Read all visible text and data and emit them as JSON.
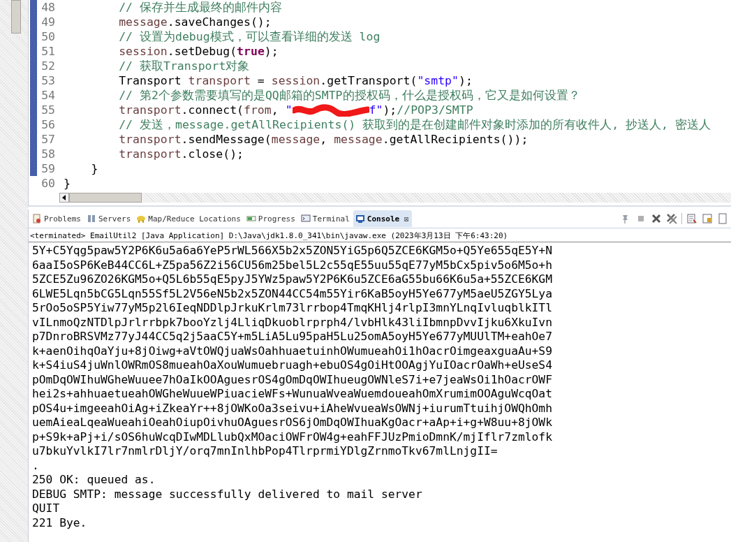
{
  "editor": {
    "lines": [
      {
        "number": "48",
        "marked": true,
        "kind": "body",
        "tokens": [
          {
            "kind": "comment",
            "text": "// 保存并生成最终的邮件内容"
          }
        ]
      },
      {
        "number": "49",
        "marked": true,
        "kind": "body",
        "tokens": [
          {
            "kind": "variable",
            "text": "message"
          },
          {
            "kind": "plain",
            "text": ".saveChanges();"
          }
        ]
      },
      {
        "number": "50",
        "marked": true,
        "kind": "body",
        "tokens": [
          {
            "kind": "comment",
            "text": "// 设置为debug模式，可以查看详细的发送 log"
          }
        ]
      },
      {
        "number": "51",
        "marked": true,
        "kind": "body",
        "tokens": [
          {
            "kind": "variable",
            "text": "session"
          },
          {
            "kind": "plain",
            "text": ".setDebug("
          },
          {
            "kind": "keyword",
            "text": "true"
          },
          {
            "kind": "plain",
            "text": ");"
          }
        ]
      },
      {
        "number": "52",
        "marked": true,
        "kind": "body",
        "tokens": [
          {
            "kind": "comment",
            "text": "// 获取Transport对象"
          }
        ]
      },
      {
        "number": "53",
        "marked": true,
        "kind": "body",
        "tokens": [
          {
            "kind": "plain",
            "text": "Transport "
          },
          {
            "kind": "variable",
            "text": "transport"
          },
          {
            "kind": "plain",
            "text": " = "
          },
          {
            "kind": "variable",
            "text": "session"
          },
          {
            "kind": "plain",
            "text": ".getTransport("
          },
          {
            "kind": "string",
            "text": "\"smtp\""
          },
          {
            "kind": "plain",
            "text": ");"
          }
        ]
      },
      {
        "number": "54",
        "marked": true,
        "kind": "body",
        "tokens": [
          {
            "kind": "comment",
            "text": "// 第2个参数需要填写的是QQ邮箱的SMTP的授权码，什么是授权码，它又是如何设置？"
          }
        ]
      },
      {
        "number": "55",
        "marked": true,
        "kind": "body",
        "tokens": [
          {
            "kind": "variable",
            "text": "transport"
          },
          {
            "kind": "plain",
            "text": ".connect("
          },
          {
            "kind": "variable",
            "text": "from"
          },
          {
            "kind": "plain",
            "text": ", "
          },
          {
            "kind": "string",
            "text": "\""
          },
          {
            "kind": "redaction"
          },
          {
            "kind": "string",
            "text": "f\""
          },
          {
            "kind": "plain",
            "text": ");"
          },
          {
            "kind": "comment",
            "text": "//POP3/SMTP"
          }
        ]
      },
      {
        "number": "56",
        "marked": true,
        "kind": "body",
        "tokens": [
          {
            "kind": "comment",
            "text": "// 发送，message.getAllRecipients() 获取到的是在创建邮件对象时添加的所有收件人, 抄送人, 密送人"
          }
        ]
      },
      {
        "number": "57",
        "marked": true,
        "kind": "body",
        "tokens": [
          {
            "kind": "variable",
            "text": "transport"
          },
          {
            "kind": "plain",
            "text": ".sendMessage("
          },
          {
            "kind": "variable",
            "text": "message"
          },
          {
            "kind": "plain",
            "text": ", "
          },
          {
            "kind": "variable",
            "text": "message"
          },
          {
            "kind": "plain",
            "text": ".getAllRecipients());"
          }
        ]
      },
      {
        "number": "58",
        "marked": true,
        "kind": "body",
        "tokens": [
          {
            "kind": "variable",
            "text": "transport"
          },
          {
            "kind": "plain",
            "text": ".close();"
          }
        ]
      },
      {
        "number": "59",
        "marked": true,
        "kind": "block",
        "tokens": [
          {
            "kind": "plain",
            "text": "}"
          }
        ]
      },
      {
        "number": "60",
        "marked": false,
        "kind": "top",
        "tokens": [
          {
            "kind": "plain",
            "text": "}"
          }
        ]
      }
    ]
  },
  "console": {
    "tabs": [
      {
        "label": "Problems",
        "kind": "problems",
        "selected": false
      },
      {
        "label": "Servers",
        "kind": "servers",
        "selected": false
      },
      {
        "label": "Map/Reduce Locations",
        "kind": "mapreduce",
        "selected": false
      },
      {
        "label": "Progress",
        "kind": "progress",
        "selected": false
      },
      {
        "label": "Terminal",
        "kind": "terminal",
        "selected": false
      },
      {
        "label": "Console",
        "kind": "console",
        "selected": true,
        "close": "☒"
      }
    ],
    "toolbar": [
      {
        "kind": "pin"
      },
      {
        "kind": "stop"
      },
      {
        "kind": "remove"
      },
      {
        "kind": "remove-all"
      },
      {
        "kind": "clear"
      },
      {
        "kind": "scroll-lock"
      },
      {
        "kind": "display"
      }
    ],
    "status": "<terminated> EmailUtil2 [Java Application] D:\\Java\\jdk1.8.0_341\\bin\\javaw.exe (2023年3月13日 下午6:43:20)",
    "output": [
      "5Y+C5Yqg5paw5Y2P6K6u5a6a6YeP5rWL566X5b2x5ZON5YiG5p6Q5ZCE6KGM5o+Q5Ye655qE5Y+N",
      "6aaI5oSP6KeB44CC6L+Z5pa56Z2i56CU56m25bel5L2c55qE55uu55qE77yM5bCx5piv5o6M5o+h",
      "5ZCE5Zu96ZO26KGM5o+Q5L6b55qE5pyJ5YWz5paw5Y2P6K6u5ZCE6aG55bu66K6u5a+55ZCE6KGM",
      "6LWE5Lqn5bCG5Lqn55Sf5L2V56eN5b2x5ZON44CC54m55Yir6KaB5oyH5Ye677yM5aeU5ZGY5Lya",
      "5rOo5oSP5Yiw77yM5p2l6IeqNDDlpJrkuKrlm73lrrbop4TmqKHlj4rlpI3mnYLnqIvluqblkITl",
      "vILnmoQzNTDlpJrlrrbpk7booYzlj4LliqDkuoblrprph4/lvbHlk43liIbmnpDvvIjku6XkuIvn",
      "p7DnroBRSVMz77yJ44CC5q2j5aaC5Y+m5LiA5Lu95paH5Lu25omA5oyH5Ye677yMUUlTM+eahOe7",
      "k+aenOihqOaYju+8jOiwg+aVtOWQjuaWsOahhuaetuinhOWumueahOi1hOacrOimgeaxguaAu+S9",
      "k+S4iuS4juWnlOWRmOS8mueahOaXouWumuebruagh+ebuOS4gOiHtOOAgjYuIOacrOaWh+eUseS4",
      "pOmDqOWIhuWGheWuuee7hOaIkOOAguesrOS4gOmDqOWIhueugOWNleS7i+e7jeaWsOi1hOacrOWF",
      "hei2s+ahhuaetueahOWGheWuueWPiuacieWFs+WunuaWveaWuemdoueahOmXrumimOOAguWcqOat",
      "pOS4u+imgeeahOiAg+iZkeaYr++8jOWKoOa3seivu+iAheWvueaWsOWNj+iurumTtuihjOWQhOmh",
      "uemAieaLqeaWueahiOeahOiupOivhuOAguesrOS6jOmDqOWIhuaKgOacr+aAp+i+g+W8uu+8jOWk",
      "p+S9k+aPj+i/sOS6huWcqDIwMDLlubQxMOaciOWFrOW4g+eahFFJUzPmioDmnK/mjIflr7zmlofk",
      "u7bkuYvlkI7lr7nmlrDljY/orq7mnInlhbPop4TlrprmiYDlgZrnmoTkv67mlLnjgII=",
      ".",
      "250 OK: queued as.",
      "DEBUG SMTP: message successfully delivered to mail server",
      "QUIT",
      "221 Bye."
    ]
  }
}
